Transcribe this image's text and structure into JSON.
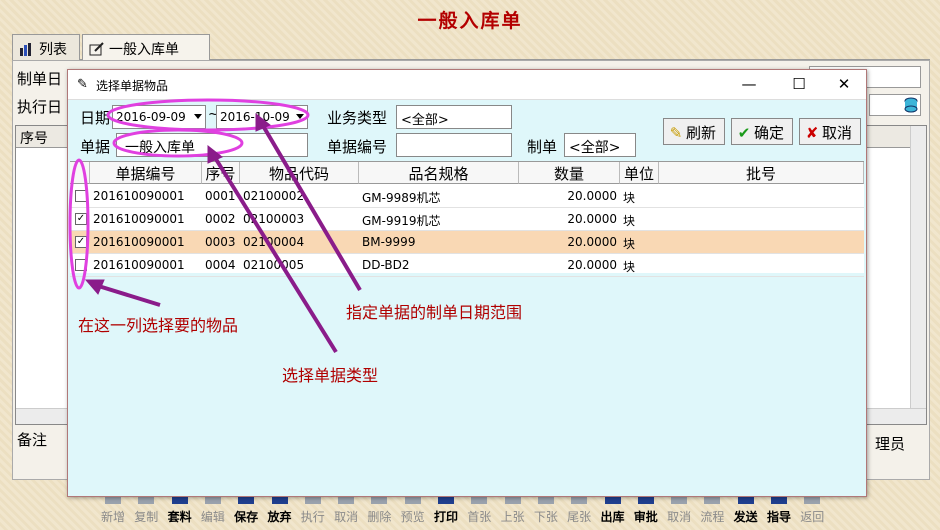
{
  "app": {
    "title": "一般入库单",
    "tabs": [
      {
        "label": "列表"
      },
      {
        "label": "一般入库单"
      }
    ],
    "bg_labels": {
      "make_date": "制单日",
      "exec_date": "执行日",
      "seq": "序号",
      "remark": "备注",
      "clerk": "理员"
    },
    "toolbar": [
      "新增",
      "复制",
      "套料",
      "编辑",
      "保存",
      "放弃",
      "执行",
      "取消",
      "删除",
      "预览",
      "打印",
      "首张",
      "上张",
      "下张",
      "尾张",
      "出库",
      "审批",
      "取消",
      "流程",
      "发送",
      "指导",
      "返回"
    ],
    "toolbar_active": [
      "套料",
      "保存",
      "放弃",
      "打印",
      "出库",
      "审批",
      "发送",
      "指导"
    ]
  },
  "dialog": {
    "title": "选择单据物品",
    "labels": {
      "date": "日期",
      "tilde": "~",
      "biz_type": "业务类型",
      "doc": "单据",
      "doc_no": "单据编号",
      "maker": "制单"
    },
    "date_from": "2016-09-09",
    "date_to": "2016-10-09",
    "biz_type_value": "<全部>",
    "doc_value": "一般入库单",
    "doc_no_value": "",
    "maker_value": "<全部>",
    "buttons": {
      "refresh": "刷新",
      "confirm": "确定",
      "cancel": "取消"
    },
    "columns": [
      "单据编号",
      "序号",
      "物品代码",
      "品名规格",
      "数量",
      "单位",
      "批号"
    ],
    "rows": [
      {
        "checked": false,
        "doc_no": "201610090001",
        "seq": "0001",
        "code": "02100002",
        "name": "GM-9989机芯",
        "qty": "20.0000",
        "unit": "块",
        "batch": ""
      },
      {
        "checked": true,
        "doc_no": "201610090001",
        "seq": "0002",
        "code": "02100003",
        "name": "GM-9919机芯",
        "qty": "20.0000",
        "unit": "块",
        "batch": ""
      },
      {
        "checked": true,
        "doc_no": "201610090001",
        "seq": "0003",
        "code": "02100004",
        "name": "BM-9999",
        "qty": "20.0000",
        "unit": "块",
        "batch": ""
      },
      {
        "checked": false,
        "doc_no": "201610090001",
        "seq": "0004",
        "code": "02100005",
        "name": "DD-BD2",
        "qty": "20.0000",
        "unit": "块",
        "batch": ""
      }
    ]
  },
  "annotations": {
    "select_items": "在这一列选择要的物品",
    "date_range": "指定单据的制单日期范围",
    "doc_type": "选择单据类型"
  },
  "colors": {
    "annotation": "#b00000",
    "highlight_ellipse": "#e040e0",
    "arrow": "#8a1c8a",
    "dialog_bg": "#dff7fa",
    "selected_row": "#f9d8b4"
  }
}
